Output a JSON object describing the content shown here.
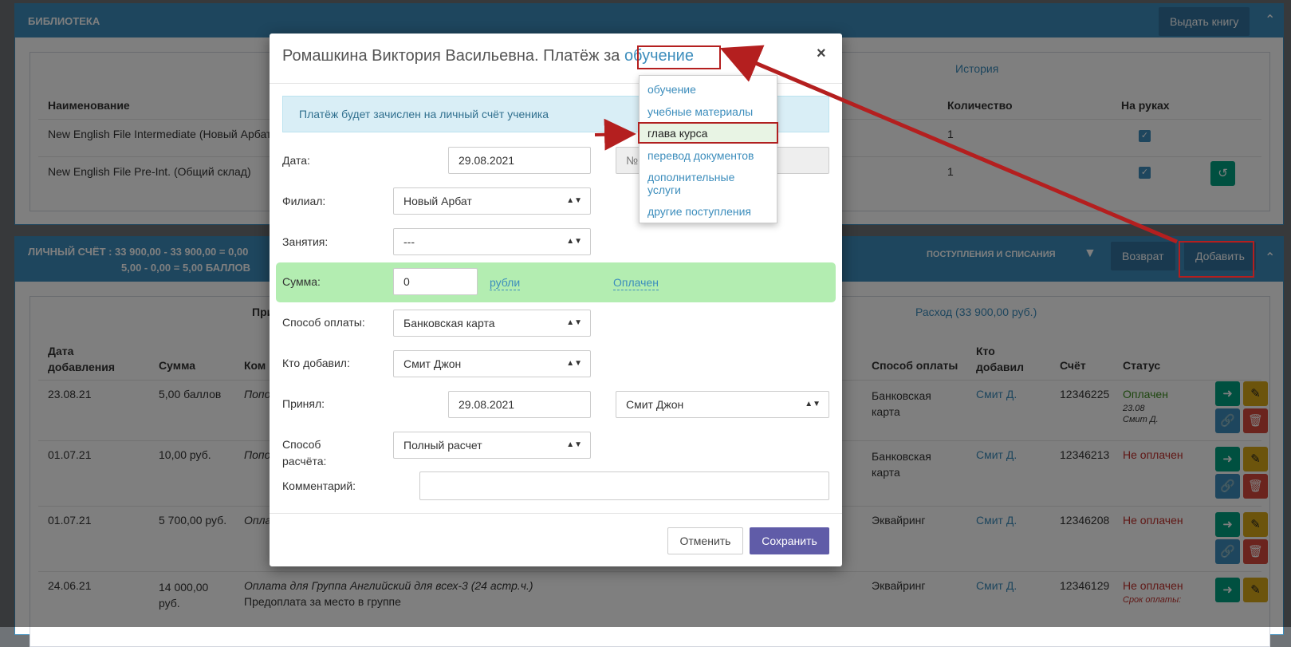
{
  "library": {
    "title": "БИБЛИОТЕКА",
    "issue_button": "Выдать книгу",
    "history_label": "История",
    "col_name": "Наименование",
    "col_qty": "Количество",
    "col_onhand": "На руках",
    "rows": [
      {
        "name": "New English File Intermediate (Новый Арбат",
        "qty": "1"
      },
      {
        "name": "New English File Pre-Int. (Общий склад)",
        "qty": "1"
      }
    ]
  },
  "account": {
    "title_line1": "ЛИЧНЫЙ СЧЁТ : 33 900,00 - 33 900,00 = 0,00",
    "title_line2": "5,00 - 0,00 = 5,00 БАЛЛОВ",
    "ops_label": "ПОСТУПЛЕНИЯ И СПИСАНИЯ",
    "return_button": "Возврат",
    "add_button": "Добавить",
    "income_label": "Прихо",
    "expense_label": "Расход (33 900,00 руб.)",
    "headers": {
      "date": "Дата добавления",
      "sum": "Сумма",
      "comment": "Ком",
      "method": "Способ оплаты",
      "who": "Кто добавил",
      "invoice": "Счёт",
      "status": "Статус"
    },
    "rows": [
      {
        "date": "23.08.21",
        "sum": "5,00 баллов",
        "comment": "Попо",
        "method": "Банковская карта",
        "who": "Смит Д.",
        "invoice": "12346225",
        "status": "Оплачен",
        "status_note1": "23.08",
        "status_note2": "Смит Д."
      },
      {
        "date": "01.07.21",
        "sum": "10,00 руб.",
        "comment": "Попо",
        "method": "Банковская карта",
        "who": "Смит Д.",
        "invoice": "12346213",
        "status": "Не оплачен"
      },
      {
        "date": "01.07.21",
        "sum": "5 700,00 руб.",
        "comment": "Опла",
        "method": "Эквайринг",
        "who": "Смит Д.",
        "invoice": "12346208",
        "status": "Не оплачен"
      },
      {
        "date": "24.06.21",
        "sum": "14 000,00 руб.",
        "comment": "Оплата для Группа Английский для всех-3 (24 астр.ч.)",
        "comment2": "Предоплата за место в группе",
        "method": "Эквайринг",
        "who": "Смит Д.",
        "invoice": "12346129",
        "status": "Не оплачен",
        "status_note1": "Срок оплаты:"
      }
    ]
  },
  "modal": {
    "title_prefix": "Ромашкина Виктория Васильевна. Платёж за",
    "title_dropdown": "обучение",
    "close": "×",
    "info": "Платёж будет зачислен на личный счёт ученика",
    "date_label": "Дата:",
    "date_value": "29.08.2021",
    "number_placeholder": "№",
    "branch_label": "Филиал:",
    "branch_value": "Новый Арбат",
    "lessons_label": "Занятия:",
    "lessons_value": "---",
    "sum_label": "Сумма:",
    "sum_value": "0",
    "currency": "рубли",
    "paid": "Оплачен",
    "method_label": "Способ оплаты:",
    "method_value": "Банковская карта",
    "added_by_label": "Кто добавил:",
    "added_by_value": "Смит Джон",
    "accepted_label": "Принял:",
    "accepted_date": "29.08.2021",
    "accepted_by": "Смит Джон",
    "settle_label_1": "Способ",
    "settle_label_2": "расчёта:",
    "settle_value": "Полный расчет",
    "comment_label": "Комментарий:",
    "cancel": "Отменить",
    "save": "Сохранить"
  },
  "dropdown": {
    "items": [
      "обучение",
      "учебные материалы",
      "глава курса",
      "перевод документов",
      "дополнительные услуги",
      "другие поступления"
    ],
    "highlighted_index": 2
  },
  "colors": {
    "primary": "#3c8dbc",
    "annotation": "#b41f1f",
    "save": "#605ca8",
    "sum_bg": "#b3edb1"
  }
}
